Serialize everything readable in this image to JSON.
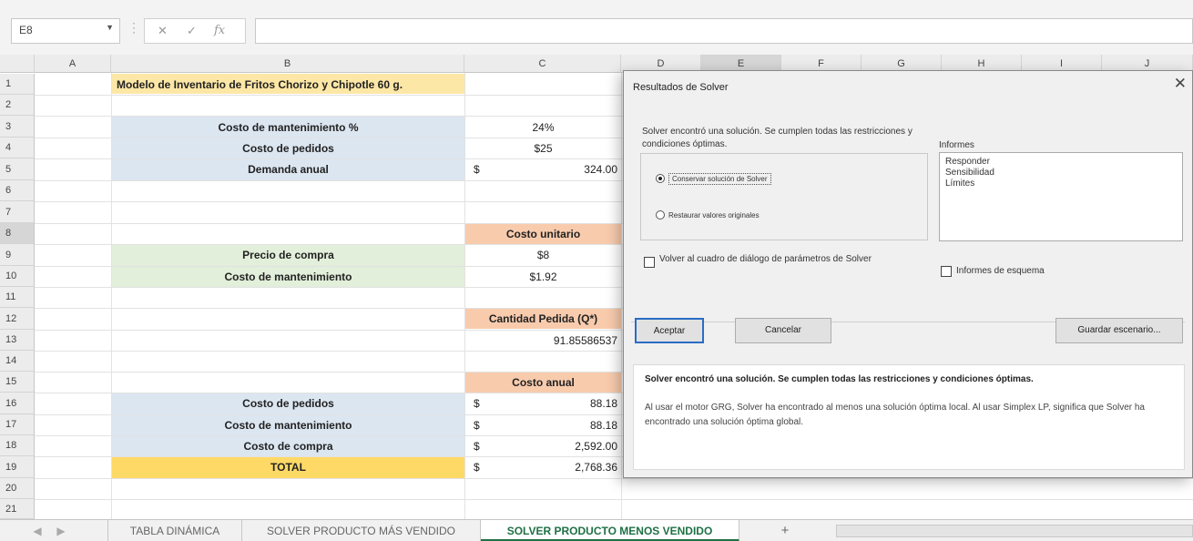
{
  "formula_bar": {
    "name_box": "E8",
    "cancel_glyph": "✕",
    "enter_glyph": "✓",
    "fx_glyph": "fx",
    "formula": ""
  },
  "columns": [
    "A",
    "B",
    "C",
    "D",
    "E",
    "F",
    "G",
    "H",
    "I",
    "J"
  ],
  "rows": [
    "1",
    "2",
    "3",
    "4",
    "5",
    "6",
    "7",
    "8",
    "9",
    "10",
    "11",
    "12",
    "13",
    "14",
    "15",
    "16",
    "17",
    "18",
    "19",
    "20",
    "21"
  ],
  "cells": {
    "B1": "Modelo de Inventario de Fritos Chorizo y Chipotle 60 g.",
    "B3": "Costo de mantenimiento %",
    "C3": "24%",
    "B4": "Costo de pedidos",
    "C4": "$25",
    "B5": "Demanda anual",
    "C5_cur": "$",
    "C5": "324.00",
    "C8": "Costo unitario",
    "B9": "Precio de compra",
    "C9": "$8",
    "B10": "Costo de mantenimiento",
    "C10": "$1.92",
    "C12": "Cantidad Pedida (Q*)",
    "C13": "91.85586537",
    "C15": "Costo anual",
    "B16": "Costo de pedidos",
    "C16_cur": "$",
    "C16": "88.18",
    "B17": "Costo de mantenimiento",
    "C17_cur": "$",
    "C17": "88.18",
    "B18": "Costo de compra",
    "C18_cur": "$",
    "C18": "2,592.00",
    "B19": "TOTAL",
    "C19_cur": "$",
    "C19": "2,768.36"
  },
  "colors": {
    "title_yellow": "#fce7a6",
    "blue_fill": "#dce6f1",
    "green_fill": "#e2efda",
    "orange_fill": "#f8cbad",
    "total_yellow": "#ffd966",
    "active_tab": "#1e7145"
  },
  "sheet_tabs": {
    "nav_prev": "◀",
    "nav_next": "▶",
    "tab1": "TABLA DINÁMICA",
    "tab2": "SOLVER PRODUCTO MÁS VENDIDO",
    "tab3": "SOLVER PRODUCTO MENOS VENDIDO",
    "add": "+"
  },
  "dialog": {
    "title": "Resultados de Solver",
    "close": "✕",
    "message": "Solver encontró una solución. Se cumplen todas las restricciones y condiciones óptimas.",
    "radio_keep": "Conservar solución de Solver",
    "radio_restore": "Restaurar valores originales",
    "reports_label": "Informes",
    "reports": [
      "Responder",
      "Sensibilidad",
      "Límites"
    ],
    "check_return": "Volver al cuadro de diálogo de parámetros de Solver",
    "check_outline": "Informes de esquema",
    "btn_ok": "Aceptar",
    "btn_cancel": "Cancelar",
    "btn_save": "Guardar escenario...",
    "info_bold": "Solver encontró una solución. Se cumplen todas las restricciones y condiciones óptimas.",
    "info_text": "Al usar el motor GRG, Solver ha encontrado al menos una solución óptima local. Al usar Simplex LP, significa que Solver ha encontrado una solución óptima global."
  }
}
